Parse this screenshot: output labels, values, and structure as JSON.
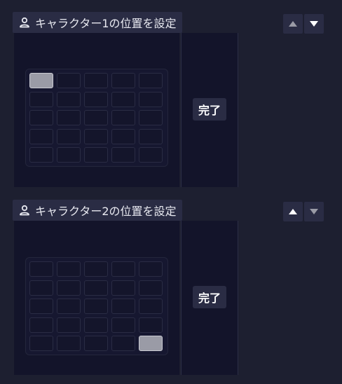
{
  "panels": [
    {
      "title": "キャラクター1の位置を設定",
      "icon": "person-icon",
      "done_label": "完了",
      "selected_cell": 0,
      "up_arrow_color": "#9a9ba6",
      "down_arrow_color": "#ffffff"
    },
    {
      "title": "キャラクター2の位置を設定",
      "icon": "person-icon",
      "done_label": "完了",
      "selected_cell": 24,
      "up_arrow_color": "#ffffff",
      "down_arrow_color": "#9a9ba6"
    }
  ],
  "grid": {
    "rows": 5,
    "cols": 5
  },
  "colors": {
    "background": "#1d1f30",
    "header": "#2a2c44",
    "grid_area": "#13142a",
    "selected_cell": "#9a9ba6"
  }
}
